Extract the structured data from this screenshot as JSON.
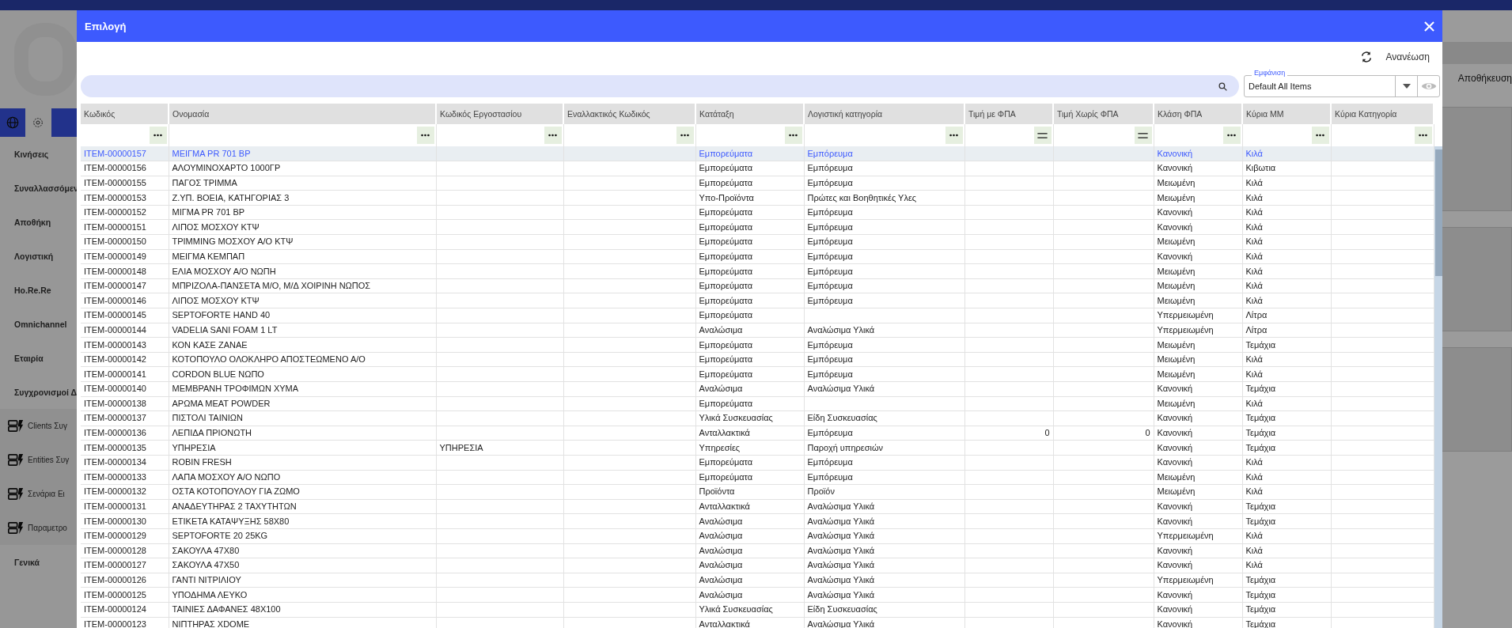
{
  "sidebar": {
    "items": [
      {
        "label": "Κινήσεις",
        "kind": "text"
      },
      {
        "label": "Συναλλασσόμεν",
        "kind": "text"
      },
      {
        "label": "Αποθήκη",
        "kind": "text"
      },
      {
        "label": "Λογιστική",
        "kind": "text"
      },
      {
        "label": "Ho.Re.Re",
        "kind": "text"
      },
      {
        "label": "Omnichannel",
        "kind": "text"
      },
      {
        "label": "Εταιρία",
        "kind": "text"
      },
      {
        "label": "Συγχρονισμοί Δ",
        "kind": "text"
      },
      {
        "label": "Clients Συγ",
        "kind": "sync"
      },
      {
        "label": "Entities Συγ",
        "kind": "sync"
      },
      {
        "label": "Σενάρια Ει",
        "kind": "sync"
      },
      {
        "label": "Παραμετρο",
        "kind": "sync"
      },
      {
        "label": "Γενικά",
        "kind": "text"
      }
    ]
  },
  "background_toolbar": {
    "save_label": "Αποθήκευση"
  },
  "dialog": {
    "title": "Επιλογή",
    "refresh_label": "Ανανέωση",
    "view_select": {
      "label": "Εμφάνιση",
      "value": "Default All Items"
    },
    "table": {
      "columns": [
        {
          "label": "Κωδικός",
          "kind": "menu"
        },
        {
          "label": "Ονομασία",
          "kind": "menu"
        },
        {
          "label": "Κωδικός Εργοστασίου",
          "kind": "menu"
        },
        {
          "label": "Εναλλακτικός Κωδικός",
          "kind": "menu"
        },
        {
          "label": "Κατάταξη",
          "kind": "menu"
        },
        {
          "label": "Λογιστική κατηγορία",
          "kind": "menu"
        },
        {
          "label": "Τιμή με ΦΠΑ",
          "kind": "equals"
        },
        {
          "label": "Τιμή Χωρίς ΦΠΑ",
          "kind": "equals"
        },
        {
          "label": "Κλάση ΦΠΑ",
          "kind": "menu"
        },
        {
          "label": "Κύρια ΜΜ",
          "kind": "menu"
        },
        {
          "label": "Κύρια Κατηγορία",
          "kind": "menu"
        }
      ],
      "rows": [
        {
          "selected": true,
          "cells": [
            "ITEM-00000157",
            "ΜΕΙΓΜΑ PR 701 BP",
            null,
            null,
            "Εμπορεύματα",
            "Εμπόρευμα",
            null,
            null,
            "Κανονική",
            "Κιλά"
          ]
        },
        {
          "selected": false,
          "cells": [
            "ITEM-00000156",
            "ΑΛΟΥΜΙΝΟΧΑΡΤΟ 1000ΓΡ",
            null,
            null,
            "Εμπορεύματα",
            "Εμπόρευμα",
            null,
            null,
            "Κανονική",
            "Κιβωτια"
          ]
        },
        {
          "selected": false,
          "cells": [
            "ITEM-00000155",
            "ΠΑΓΟΣ ΤΡΙΜΜΑ",
            null,
            null,
            "Εμπορεύματα",
            "Εμπόρευμα",
            null,
            null,
            "Μειωμένη",
            "Κιλά"
          ]
        },
        {
          "selected": false,
          "cells": [
            "ITEM-00000153",
            "Ζ.ΥΠ. ΒΟΕΙΑ, ΚΑΤΗΓΟΡΙΑΣ 3",
            null,
            null,
            "Υπο-Προϊόντα",
            "Πρώτες και Βοηθητικές Υλες",
            null,
            null,
            "Μειωμένη",
            "Κιλά"
          ]
        },
        {
          "selected": false,
          "cells": [
            "ITEM-00000152",
            "ΜΙΓΜΑ PR 701 BP",
            null,
            null,
            "Εμπορεύματα",
            "Εμπόρευμα",
            null,
            null,
            "Κανονική",
            "Κιλά"
          ]
        },
        {
          "selected": false,
          "cells": [
            "ITEM-00000151",
            "ΛΙΠΟΣ ΜΟΣΧΟΥ ΚΤΨ",
            null,
            null,
            "Εμπορεύματα",
            "Εμπόρευμα",
            null,
            null,
            "Κανονική",
            "Κιλά"
          ]
        },
        {
          "selected": false,
          "cells": [
            "ITEM-00000150",
            "ΤΡΙΜΜING ΜΟΣΧΟΥ Α/Ο ΚΤΨ",
            null,
            null,
            "Εμπορεύματα",
            "Εμπόρευμα",
            null,
            null,
            "Μειωμένη",
            "Κιλά"
          ]
        },
        {
          "selected": false,
          "cells": [
            "ITEM-00000149",
            "ΜΕΙΓΜΑ ΚΕΜΠΑΠ",
            null,
            null,
            "Εμπορεύματα",
            "Εμπόρευμα",
            null,
            null,
            "Κανονική",
            "Κιλά"
          ]
        },
        {
          "selected": false,
          "cells": [
            "ITEM-00000148",
            "ΕΛΙΑ ΜΟΣΧΟΥ Α/Ο ΝΩΠΗ",
            null,
            null,
            "Εμπορεύματα",
            "Εμπόρευμα",
            null,
            null,
            "Μειωμένη",
            "Κιλά"
          ]
        },
        {
          "selected": false,
          "cells": [
            "ITEM-00000147",
            "ΜΠΡΙΖΟΛΑ-ΠΑΝΣΕΤΑ Μ/Ο, Μ/Δ ΧΟΙΡΙΝΗ ΝΩΠΟΣ",
            null,
            null,
            "Εμπορεύματα",
            "Εμπόρευμα",
            null,
            null,
            "Μειωμένη",
            "Κιλά"
          ]
        },
        {
          "selected": false,
          "cells": [
            "ITEM-00000146",
            "ΛΙΠΟΣ ΜΟΣΧΟΥ ΚΤΨ",
            null,
            null,
            "Εμπορεύματα",
            "Εμπόρευμα",
            null,
            null,
            "Μειωμένη",
            "Κιλά"
          ]
        },
        {
          "selected": false,
          "cells": [
            "ITEM-00000145",
            "SEPTOFORTE HAND 40",
            null,
            null,
            "Εμπορεύματα",
            null,
            null,
            null,
            "Υπερμειωμένη",
            "Λίτρα"
          ]
        },
        {
          "selected": false,
          "cells": [
            "ITEM-00000144",
            "VADELIA SANI FOAM 1 LT",
            null,
            null,
            "Αναλώσιμα",
            "Αναλώσιμα Υλικά",
            null,
            null,
            "Υπερμειωμένη",
            "Λίτρα"
          ]
        },
        {
          "selected": false,
          "cells": [
            "ITEM-00000143",
            "ΚΟΝ ΚΑΣΕ ΖΑΝΑΕ",
            null,
            null,
            "Εμπορεύματα",
            "Εμπόρευμα",
            null,
            null,
            "Μειωμένη",
            "Τεμάχια"
          ]
        },
        {
          "selected": false,
          "cells": [
            "ITEM-00000142",
            "ΚΟΤΟΠΟΥΛΟ ΟΛΟΚΛΗΡΟ ΑΠΟΣΤΕΩΜΕΝΟ Α/Ο",
            null,
            null,
            "Εμπορεύματα",
            "Εμπόρευμα",
            null,
            null,
            "Μειωμένη",
            "Κιλά"
          ]
        },
        {
          "selected": false,
          "cells": [
            "ITEM-00000141",
            "CORDON BLUE ΝΩΠΟ",
            null,
            null,
            "Εμπορεύματα",
            "Εμπόρευμα",
            null,
            null,
            "Μειωμένη",
            "Κιλά"
          ]
        },
        {
          "selected": false,
          "cells": [
            "ITEM-00000140",
            "ΜΕΜΒΡΑΝΗ ΤΡΟΦΙΜΩΝ ΧΥΜΑ",
            null,
            null,
            "Αναλώσιμα",
            "Αναλώσιμα Υλικά",
            null,
            null,
            "Κανονική",
            "Τεμάχια"
          ]
        },
        {
          "selected": false,
          "cells": [
            "ITEM-00000138",
            "ΑΡΩΜΑ MEAT POWDER",
            null,
            null,
            "Εμπορεύματα",
            null,
            null,
            null,
            "Μειωμένη",
            "Κιλά"
          ]
        },
        {
          "selected": false,
          "cells": [
            "ITEM-00000137",
            "ΠΙΣΤΟΛΙ ΤΑΙΝΙΩΝ",
            null,
            null,
            "Υλικά Συσκευασίας",
            "Είδη Συσκευασίας",
            null,
            null,
            "Κανονική",
            "Τεμάχια"
          ]
        },
        {
          "selected": false,
          "cells": [
            "ITEM-00000136",
            "ΛΕΠΙΔΑ ΠΡΙΟΝΩΤΗ",
            null,
            null,
            "Ανταλλακτικά",
            "Εμπόρευμα",
            "0",
            "0",
            "Κανονική",
            "Τεμάχια"
          ]
        },
        {
          "selected": false,
          "cells": [
            "ITEM-00000135",
            "ΥΠΗΡΕΣΙΑ",
            "ΥΠΗΡΕΣΙΑ",
            null,
            "Υπηρεσίες",
            "Παροχή υπηρεσιών",
            null,
            null,
            "Κανονική",
            "Τεμάχια"
          ]
        },
        {
          "selected": false,
          "cells": [
            "ITEM-00000134",
            "ROBIN FRESH",
            null,
            null,
            "Εμπορεύματα",
            "Εμπόρευμα",
            null,
            null,
            "Κανονική",
            "Κιλά"
          ]
        },
        {
          "selected": false,
          "cells": [
            "ITEM-00000133",
            "ΛΑΠΑ ΜΟΣΧΟΥ Α/Ο ΝΩΠΟ",
            null,
            null,
            "Εμπορεύματα",
            "Εμπόρευμα",
            null,
            null,
            "Μειωμένη",
            "Κιλά"
          ]
        },
        {
          "selected": false,
          "cells": [
            "ITEM-00000132",
            "ΟΣΤΑ ΚΟΤΟΠΟΥΛΟΥ ΓΙΑ ΖΩΜΟ",
            null,
            null,
            "Προϊόντα",
            "Προϊόν",
            null,
            null,
            "Μειωμένη",
            "Κιλά"
          ]
        },
        {
          "selected": false,
          "cells": [
            "ITEM-00000131",
            "ΑΝΑΔΕΥΤΗΡΑΣ 2 ΤΑΧΥΤΗΤΩΝ",
            null,
            null,
            "Ανταλλακτικά",
            "Αναλώσιμα Υλικά",
            null,
            null,
            "Κανονική",
            "Τεμάχια"
          ]
        },
        {
          "selected": false,
          "cells": [
            "ITEM-00000130",
            "ΕΤΙΚΕΤΑ ΚΑΤΑΨΥΞΗΣ 58Χ80",
            null,
            null,
            "Αναλώσιμα",
            "Αναλώσιμα Υλικά",
            null,
            null,
            "Κανονική",
            "Τεμάχια"
          ]
        },
        {
          "selected": false,
          "cells": [
            "ITEM-00000129",
            "SEPTOFORTE 20 25KG",
            null,
            null,
            "Αναλώσιμα",
            "Αναλώσιμα Υλικά",
            null,
            null,
            "Υπερμειωμένη",
            "Κιλά"
          ]
        },
        {
          "selected": false,
          "cells": [
            "ITEM-00000128",
            "ΣΑΚΟΥΛΑ 47Χ80",
            null,
            null,
            "Αναλώσιμα",
            "Αναλώσιμα Υλικά",
            null,
            null,
            "Κανονική",
            "Κιλά"
          ]
        },
        {
          "selected": false,
          "cells": [
            "ITEM-00000127",
            "ΣΑΚΟΥΛΑ 47Χ50",
            null,
            null,
            "Αναλώσιμα",
            "Αναλώσιμα Υλικά",
            null,
            null,
            "Κανονική",
            "Κιλά"
          ]
        },
        {
          "selected": false,
          "cells": [
            "ITEM-00000126",
            "ΓΑΝΤΙ ΝΙΤΡΙΛΙΟΥ",
            null,
            null,
            "Αναλώσιμα",
            "Αναλώσιμα Υλικά",
            null,
            null,
            "Υπερμειωμένη",
            "Τεμάχια"
          ]
        },
        {
          "selected": false,
          "cells": [
            "ITEM-00000125",
            "ΥΠΟΔΗΜΑ ΛΕΥΚΟ",
            null,
            null,
            "Αναλώσιμα",
            "Αναλώσιμα Υλικά",
            null,
            null,
            "Κανονική",
            "Τεμάχια"
          ]
        },
        {
          "selected": false,
          "cells": [
            "ITEM-00000124",
            "ΤΑΙΝΙΕΣ ΔΑΦΑΝΕΣ 48Χ100",
            null,
            null,
            "Υλικά Συσκευασίας",
            "Είδη Συσκευασίας",
            null,
            null,
            "Κανονική",
            "Τεμάχια"
          ]
        },
        {
          "selected": false,
          "cells": [
            "ITEM-00000123",
            "ΝΙΠΤΗΡΑΣ XDOME",
            null,
            null,
            "Ανταλλακτικά",
            "Αναλώσιμα Υλικά",
            null,
            null,
            "Κανονική",
            "Τεμάχια"
          ]
        }
      ]
    }
  }
}
